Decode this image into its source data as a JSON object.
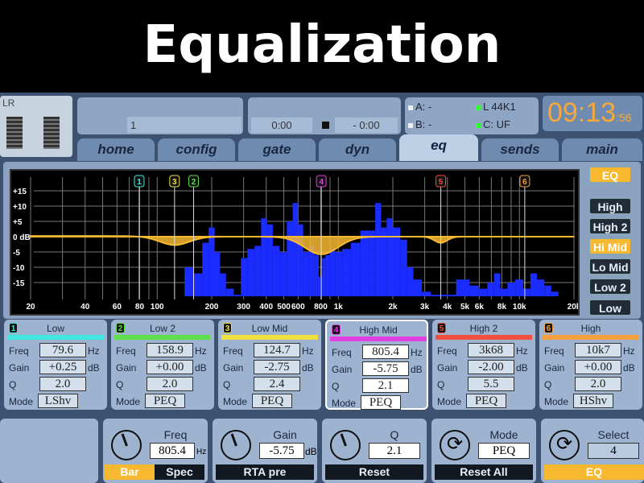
{
  "title": "Equalization",
  "channel": {
    "name": "LR",
    "number": "1"
  },
  "transport": {
    "elapsed": "0:00",
    "remaining": "- 0:00"
  },
  "status": {
    "a": "A:  -",
    "b": "B:  -",
    "l": "L  44K1",
    "c": "C:  UF"
  },
  "clock": {
    "time": "09:13",
    "seconds": ":56"
  },
  "tabs": [
    "home",
    "config",
    "gate",
    "dyn",
    "eq",
    "sends",
    "main"
  ],
  "active_tab": "eq",
  "graph": {
    "y_labels": [
      "+15",
      "+10",
      "+5",
      "0 dB",
      "-5",
      "-10",
      "-15"
    ],
    "y_values": [
      15,
      10,
      5,
      0,
      -5,
      -10,
      -15
    ],
    "x_labels": [
      [
        "20",
        20
      ],
      [
        "40",
        40
      ],
      [
        "60",
        60
      ],
      [
        "80",
        80
      ],
      [
        "100",
        100
      ],
      [
        "200",
        200
      ],
      [
        "300",
        300
      ],
      [
        "400",
        400
      ],
      [
        "500",
        500
      ],
      [
        "600",
        600
      ],
      [
        "800",
        800
      ],
      [
        "1k",
        1000
      ],
      [
        "2k",
        2000
      ],
      [
        "3k",
        3000
      ],
      [
        "4k",
        4000
      ],
      [
        "5k",
        5000
      ],
      [
        "6k",
        6000
      ],
      [
        "8k",
        8000
      ],
      [
        "10k",
        10000
      ],
      [
        "20k",
        20000
      ]
    ],
    "curve_color": "#f8b830",
    "spectrum_color": "#1a2cff",
    "spectrum": [
      [
        150,
        -10
      ],
      [
        170,
        -12
      ],
      [
        185,
        -2
      ],
      [
        200,
        3
      ],
      [
        215,
        -5
      ],
      [
        230,
        -12
      ],
      [
        250,
        -17
      ],
      [
        280,
        -19
      ],
      [
        300,
        -7
      ],
      [
        330,
        -4
      ],
      [
        360,
        -3
      ],
      [
        390,
        6
      ],
      [
        420,
        4
      ],
      [
        450,
        -3
      ],
      [
        500,
        -5
      ],
      [
        540,
        5
      ],
      [
        580,
        11
      ],
      [
        620,
        4
      ],
      [
        660,
        -5
      ],
      [
        720,
        -3
      ],
      [
        760,
        -6
      ],
      [
        800,
        -13
      ],
      [
        830,
        -7
      ],
      [
        870,
        -6
      ],
      [
        920,
        -4
      ],
      [
        1000,
        -5
      ],
      [
        1100,
        -4
      ],
      [
        1250,
        -2
      ],
      [
        1400,
        2
      ],
      [
        1550,
        2
      ],
      [
        1650,
        11
      ],
      [
        1800,
        3
      ],
      [
        1900,
        6
      ],
      [
        2100,
        3
      ],
      [
        2300,
        -1
      ],
      [
        2500,
        -10
      ],
      [
        2700,
        -14
      ],
      [
        3100,
        -18
      ],
      [
        3400,
        -19
      ],
      [
        4000,
        -19
      ],
      [
        5000,
        -14
      ],
      [
        5600,
        -16
      ],
      [
        6300,
        -17
      ],
      [
        7000,
        -15
      ],
      [
        7500,
        -12
      ],
      [
        8200,
        -17
      ],
      [
        9000,
        -15
      ],
      [
        10000,
        -14
      ],
      [
        11000,
        -17
      ],
      [
        12000,
        -12
      ],
      [
        13000,
        -14
      ],
      [
        14500,
        -16
      ],
      [
        15500,
        -18
      ]
    ]
  },
  "side_buttons": [
    {
      "label": "EQ",
      "on": true
    },
    {
      "label": "High",
      "on": false
    },
    {
      "label": "High 2",
      "on": false
    },
    {
      "label": "Hi Mid",
      "on": true
    },
    {
      "label": "Lo Mid",
      "on": false
    },
    {
      "label": "Low 2",
      "on": false
    },
    {
      "label": "Low",
      "on": false
    }
  ],
  "row_labels": {
    "freq": "Freq",
    "gain": "Gain",
    "q": "Q",
    "mode": "Mode",
    "hz": "Hz",
    "db": "dB"
  },
  "bands": [
    {
      "num": "1",
      "name": "Low",
      "color": "#3ee8e0",
      "freq": "79.6",
      "gain": "+0.25",
      "q": "2.0",
      "mode": "LShv"
    },
    {
      "num": "2",
      "name": "Low 2",
      "color": "#5de04a",
      "freq": "158.9",
      "gain": "+0.00",
      "q": "2.0",
      "mode": "PEQ"
    },
    {
      "num": "3",
      "name": "Low Mid",
      "color": "#f0e040",
      "freq": "124.7",
      "gain": "-2.75",
      "q": "2.4",
      "mode": "PEQ"
    },
    {
      "num": "4",
      "name": "High Mid",
      "color": "#e040e0",
      "freq": "805.4",
      "gain": "-5.75",
      "q": "2.1",
      "mode": "PEQ"
    },
    {
      "num": "5",
      "name": "High 2",
      "color": "#f05040",
      "freq": "3k68",
      "gain": "-2.00",
      "q": "5.5",
      "mode": "PEQ"
    },
    {
      "num": "6",
      "name": "High",
      "color": "#f8a040",
      "freq": "10k7",
      "gain": "+0.00",
      "q": "2.0",
      "mode": "HShv"
    }
  ],
  "selected_band": 3,
  "bottom": {
    "freq": {
      "label": "Freq",
      "value": "805.4",
      "unit": "Hz",
      "btn1": "Bar",
      "btn2": "Spec"
    },
    "gain": {
      "label": "Gain",
      "value": "-5.75",
      "unit": "dB",
      "btn": "RTA pre"
    },
    "q": {
      "label": "Q",
      "value": "2.1",
      "btn": "Reset"
    },
    "mode": {
      "label": "Mode",
      "value": "PEQ",
      "btn": "Reset All"
    },
    "select": {
      "label": "Select",
      "value": "4",
      "btn": "EQ"
    }
  }
}
